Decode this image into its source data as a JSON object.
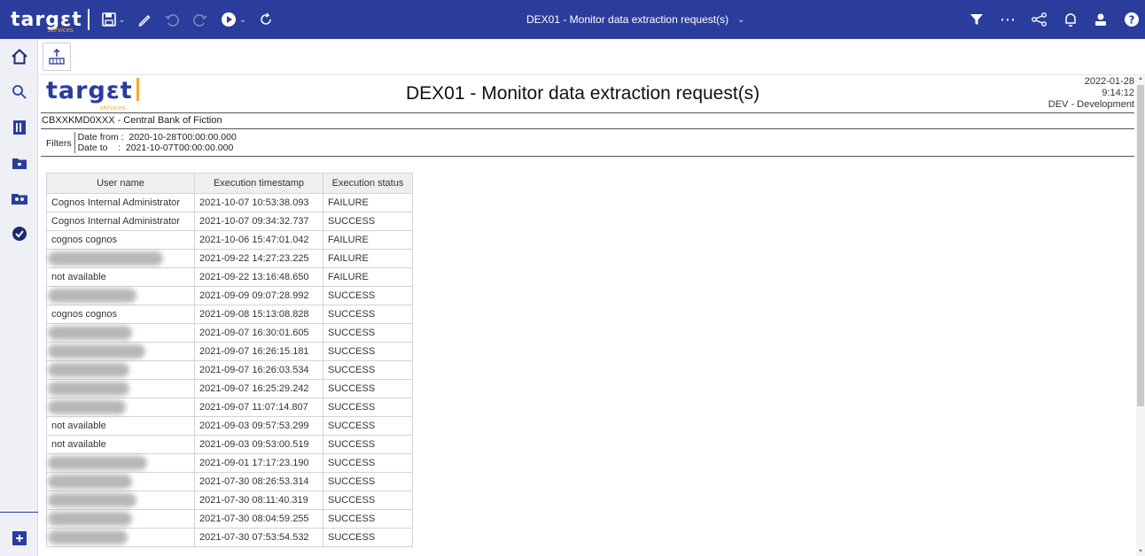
{
  "app": {
    "logo_text": "targεt",
    "logo_sub": "services",
    "title": "DEX01 - Monitor data extraction request(s)"
  },
  "toolbar": {
    "icons": [
      "save-icon",
      "pencil-icon",
      "undo-icon",
      "redo-icon",
      "run-icon",
      "refresh-icon"
    ],
    "right_icons": [
      "filter-icon",
      "more-icon",
      "share-icon",
      "bell-icon",
      "user-icon",
      "help-icon"
    ]
  },
  "sidebar": {
    "items": [
      "home-icon",
      "search-icon",
      "content-icon",
      "folder-icon",
      "team-folder-icon",
      "check-circle-icon",
      "plus-icon"
    ]
  },
  "report": {
    "logo_text": "targεt",
    "logo_sub": "services",
    "title": "DEX01 - Monitor data extraction request(s)",
    "date": "2022-01-28",
    "time": "9:14:12",
    "environment": "DEV - Development",
    "bank": "CBXXKMD0XXX - Central Bank of Fiction",
    "filters_label": "Filters",
    "filter_from": "Date from :  2020-10-28T00:00:00.000",
    "filter_to": "Date to    :  2021-10-07T00:00:00.000"
  },
  "table": {
    "headers": [
      "User name",
      "Execution timestamp",
      "Execution status"
    ],
    "rows": [
      {
        "user": "Cognos Internal Administrator",
        "ts": "2021-10-07 10:53:38.093",
        "status": "FAILURE"
      },
      {
        "user": "Cognos Internal Administrator",
        "ts": "2021-10-07 09:34:32.737",
        "status": "SUCCESS"
      },
      {
        "user": "cognos cognos",
        "ts": "2021-10-06 15:47:01.042",
        "status": "FAILURE"
      },
      {
        "user": "",
        "ts": "2021-09-22 14:27:23.225",
        "status": "FAILURE",
        "redacted": 130
      },
      {
        "user": "not available",
        "ts": "2021-09-22 13:16:48.650",
        "status": "FAILURE"
      },
      {
        "user": "",
        "ts": "2021-09-09 09:07:28.992",
        "status": "SUCCESS",
        "redacted": 100
      },
      {
        "user": "cognos cognos",
        "ts": "2021-09-08 15:13:08.828",
        "status": "SUCCESS"
      },
      {
        "user": "",
        "ts": "2021-09-07 16:30:01.605",
        "status": "SUCCESS",
        "redacted": 95
      },
      {
        "user": "",
        "ts": "2021-09-07 16:26:15.181",
        "status": "SUCCESS",
        "redacted": 110
      },
      {
        "user": "",
        "ts": "2021-09-07 16:26:03.534",
        "status": "SUCCESS",
        "redacted": 92
      },
      {
        "user": "",
        "ts": "2021-09-07 16:25:29.242",
        "status": "SUCCESS",
        "redacted": 92
      },
      {
        "user": "",
        "ts": "2021-09-07 11:07:14.807",
        "status": "SUCCESS",
        "redacted": 88
      },
      {
        "user": "not available",
        "ts": "2021-09-03 09:57:53.299",
        "status": "SUCCESS"
      },
      {
        "user": "not available",
        "ts": "2021-09-03 09:53:00.519",
        "status": "SUCCESS"
      },
      {
        "user": "",
        "ts": "2021-09-01 17:17:23.190",
        "status": "SUCCESS",
        "redacted": 112
      },
      {
        "user": "",
        "ts": "2021-07-30 08:26:53.314",
        "status": "SUCCESS",
        "redacted": 95
      },
      {
        "user": "",
        "ts": "2021-07-30 08:11:40.319",
        "status": "SUCCESS",
        "redacted": 100
      },
      {
        "user": "",
        "ts": "2021-07-30 08:04:59.255",
        "status": "SUCCESS",
        "redacted": 95
      },
      {
        "user": "",
        "ts": "2021-07-30 07:53:54.532",
        "status": "SUCCESS",
        "redacted": 90
      }
    ]
  },
  "colors": {
    "topbar": "#2b3d9c",
    "accent": "#f7a928",
    "rail": "#eef0f5"
  }
}
